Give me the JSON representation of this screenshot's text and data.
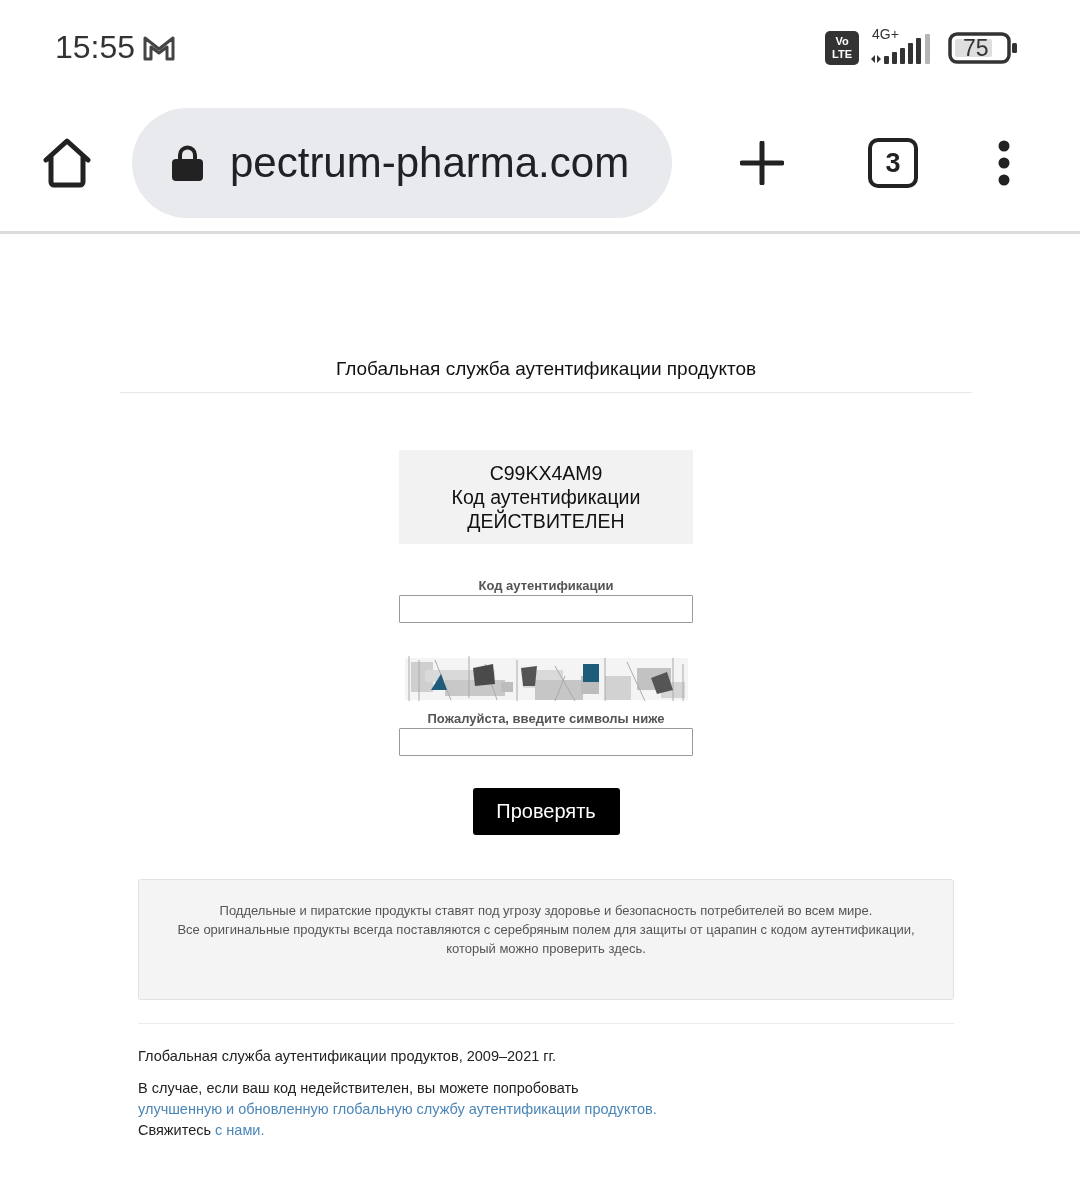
{
  "status_bar": {
    "time": "15:55",
    "network_badge": "Vo LTE",
    "network_type": "4G+",
    "battery": "75"
  },
  "browser": {
    "url": "pectrum-pharma.com",
    "tab_count": "3"
  },
  "page": {
    "title": "Глобальная служба аутентификации продуктов",
    "result": {
      "code": "C99KX4AM9",
      "label": "Код аутентификации",
      "status": "ДЕЙСТВИТЕЛЕН"
    },
    "fields": [
      {
        "kind": "text",
        "label": "Код аутентификации"
      },
      {
        "kind": "captcha",
        "label": "Пожалуйста, введите символы ниже"
      }
    ],
    "submit_button": "Проверять",
    "notice": [
      "Поддельные и пиратские продукты ставят под угрозу здоровье и безопасность потребителей во всем мире.",
      "Все оригинальные продукты всегда поставляются с серебряным полем для защиты от царапин с кодом аутентификации, который можно проверить здесь."
    ],
    "footer": {
      "copyright": "Глобальная служба аутентификации продуктов, 2009–2021 гг.",
      "fallback": {
        "text": "В случае, если ваш код недействителен, вы можете попробовать",
        "link": "улучшенную и обновленную глобальную службу аутентификации продуктов."
      },
      "contact": {
        "text": "Свяжитесь",
        "link": "с нами."
      }
    }
  }
}
